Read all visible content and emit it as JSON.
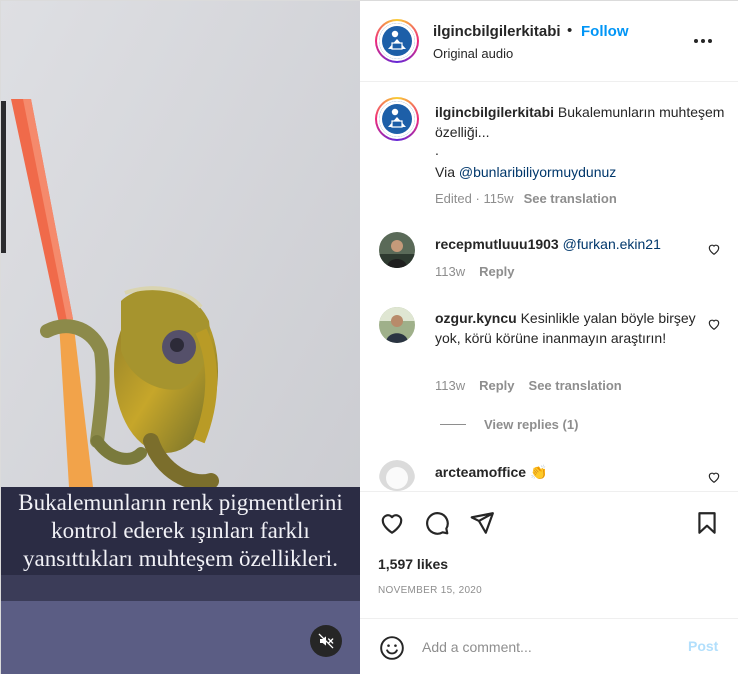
{
  "header": {
    "username": "ilgincbilgilerkitabi",
    "separator": "•",
    "follow_label": "Follow",
    "audio": "Original audio",
    "more_icon": "more-horizontal-icon"
  },
  "video": {
    "caption_lines": [
      "Bukalemunların renk pigmentlerini",
      "kontrol ederek ışınları farklı",
      "yansıttıkları muhteşem özellikleri."
    ],
    "mute_icon": "speaker-muted-icon",
    "colors": {
      "band": "#2b2c44",
      "background": "#e9e9ea",
      "pencil": "#f06a4a"
    }
  },
  "post_caption": {
    "username": "ilgincbilgilerkitabi",
    "text": "Bukalemunların muhteşem özelliği...",
    "dot": ".",
    "via_prefix": "Via ",
    "via_mention": "@bunlaribiliyormuydunuz",
    "edited": "Edited",
    "age": "115w",
    "see_translation": "See translation"
  },
  "comments": [
    {
      "username": "recepmutluuu1903",
      "text": "",
      "mention": "@furkan.ekin21",
      "age": "113w",
      "reply_label": "Reply"
    },
    {
      "username": "ozgur.kyncu",
      "text": "Kesinlikle yalan böyle birşey yok, körü körüne inanmayın araştırın!",
      "age": "113w",
      "reply_label": "Reply",
      "see_translation": "See translation",
      "view_replies": "View replies (1)"
    },
    {
      "username": "arcteamoffice",
      "text": "👏"
    }
  ],
  "actions": {
    "like_icon": "heart-icon",
    "comment_icon": "comment-bubble-icon",
    "share_icon": "paper-plane-icon",
    "save_icon": "bookmark-icon",
    "likes": "1,597 likes",
    "date": "NOVEMBER 15, 2020"
  },
  "comment_bar": {
    "emoji_icon": "emoji-smile-icon",
    "placeholder": "Add a comment...",
    "post_label": "Post"
  },
  "theme": {
    "accent": "#0095f6",
    "muted": "#8e8e8e",
    "mention": "#00376b",
    "post_disabled": "#b2dffc"
  }
}
